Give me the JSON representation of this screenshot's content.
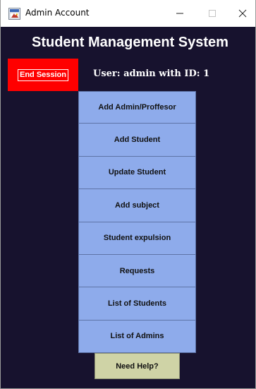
{
  "window": {
    "title": "Admin Account",
    "app_icon": "java-app-icon",
    "controls": {
      "minimize_icon": "minimize-icon",
      "maximize_icon": "maximize-icon",
      "close_icon": "close-icon"
    }
  },
  "header": {
    "title": "Student Management System",
    "user_info": "User: admin with ID: 1"
  },
  "end_session": {
    "label": "End Session",
    "color": "#ff0000"
  },
  "menu": {
    "items": [
      {
        "label": "Add Admin/Proffesor"
      },
      {
        "label": "Add Student"
      },
      {
        "label": "Update Student"
      },
      {
        "label": "Add subject"
      },
      {
        "label": "Student expulsion"
      },
      {
        "label": "Requests"
      },
      {
        "label": "List of Students"
      },
      {
        "label": "List of Admins"
      }
    ],
    "button_color": "#8eabeb"
  },
  "help": {
    "label": "Need Help?",
    "color": "#cfd3a6"
  },
  "colors": {
    "background": "#17122e",
    "text": "#ffffff"
  }
}
